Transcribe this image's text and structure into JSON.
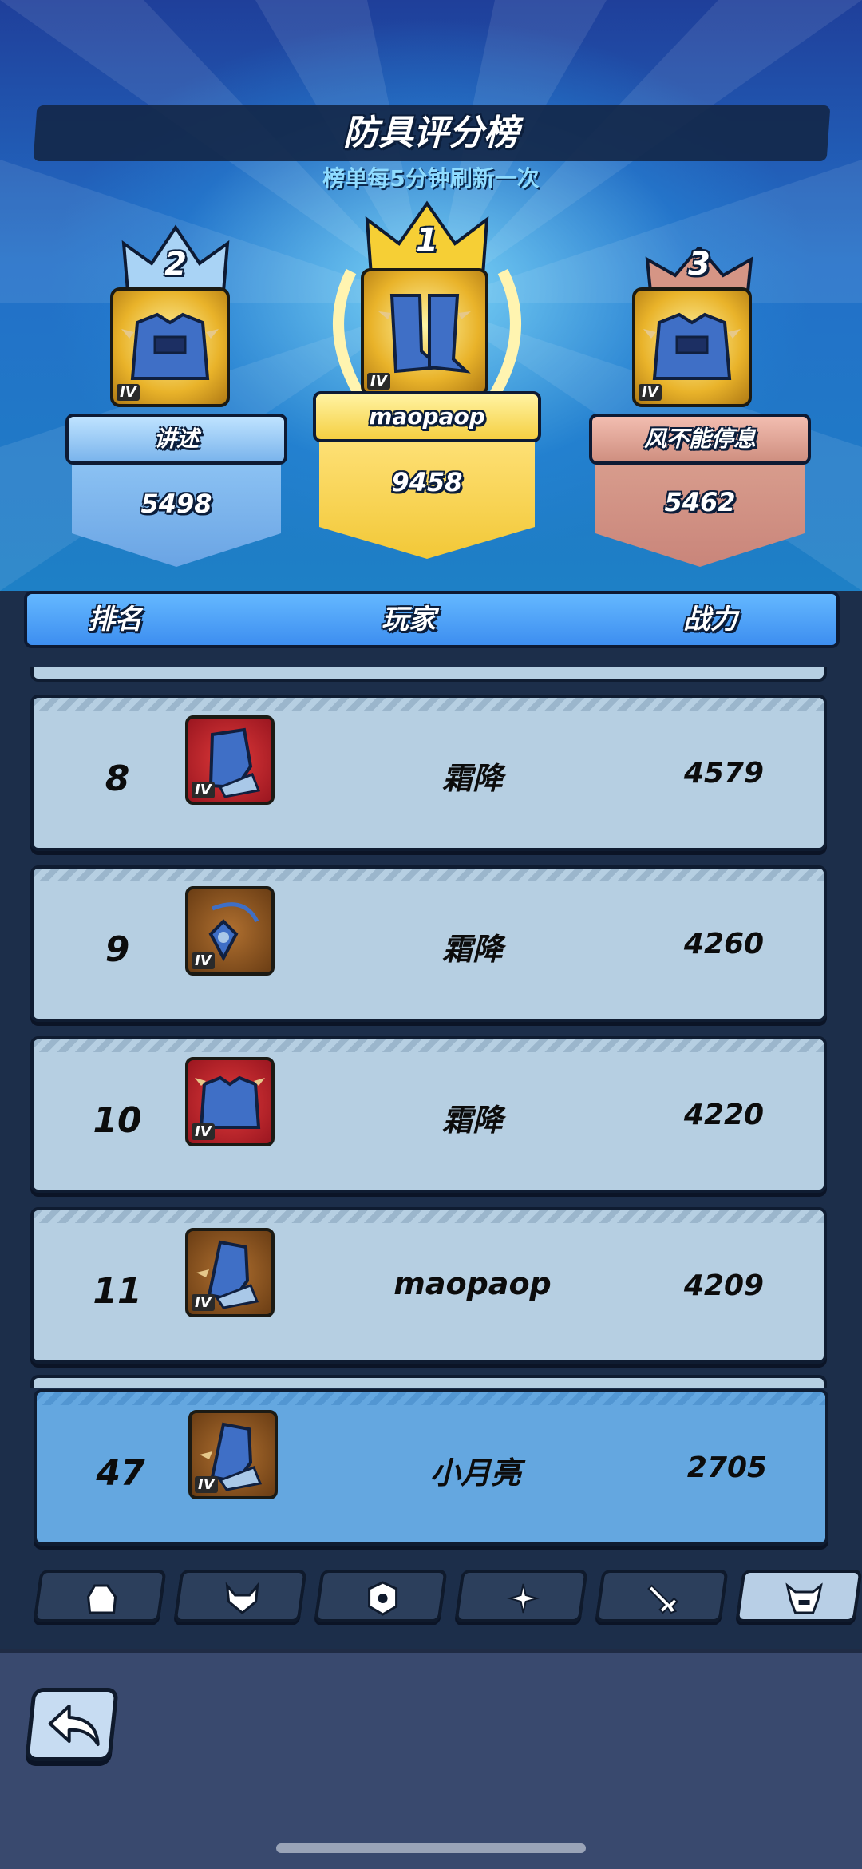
{
  "header": {
    "title": "防具评分榜",
    "subtitle": "榜单每5分钟刷新一次"
  },
  "podium": [
    {
      "rank": "2",
      "name": "讲述",
      "score": "5498",
      "tier": "IV",
      "item_icon": "armor-chest-icon"
    },
    {
      "rank": "1",
      "name": "maopaop",
      "score": "9458",
      "tier": "IV",
      "item_icon": "armor-boots-icon"
    },
    {
      "rank": "3",
      "name": "风不能停息",
      "score": "5462",
      "tier": "IV",
      "item_icon": "armor-chest-icon"
    }
  ],
  "columns": {
    "rank": "排名",
    "player": "玩家",
    "power": "战力"
  },
  "rows": [
    {
      "rank": "8",
      "name": "霜降",
      "power": "4579",
      "tier": "IV",
      "item_icon": "gauntlet-icon",
      "item_bg": "red"
    },
    {
      "rank": "9",
      "name": "霜降",
      "power": "4260",
      "tier": "IV",
      "item_icon": "amulet-icon",
      "item_bg": "brown"
    },
    {
      "rank": "10",
      "name": "霜降",
      "power": "4220",
      "tier": "IV",
      "item_icon": "chest-armor-icon",
      "item_bg": "red"
    },
    {
      "rank": "11",
      "name": "maopaop",
      "power": "4209",
      "tier": "IV",
      "item_icon": "gauntlet-icon",
      "item_bg": "brown"
    }
  ],
  "me": {
    "rank": "47",
    "name": "小月亮",
    "power": "2705",
    "tier": "IV",
    "item_icon": "gauntlet-icon"
  },
  "tabs": [
    {
      "icon": "glove-tab-icon",
      "active": false
    },
    {
      "icon": "horned-helmet-tab-icon",
      "active": false
    },
    {
      "icon": "shield-tab-icon",
      "active": false
    },
    {
      "icon": "sparkle-tab-icon",
      "active": false
    },
    {
      "icon": "sword-tab-icon",
      "active": false
    },
    {
      "icon": "helmet-tab-icon",
      "active": true
    }
  ],
  "colors": {
    "gold": "#f2c837",
    "silver_blue": "#7fb8ee",
    "bronze": "#d89887",
    "row_bg": "#b6cfe2",
    "my_row_bg": "#64a7e0"
  }
}
